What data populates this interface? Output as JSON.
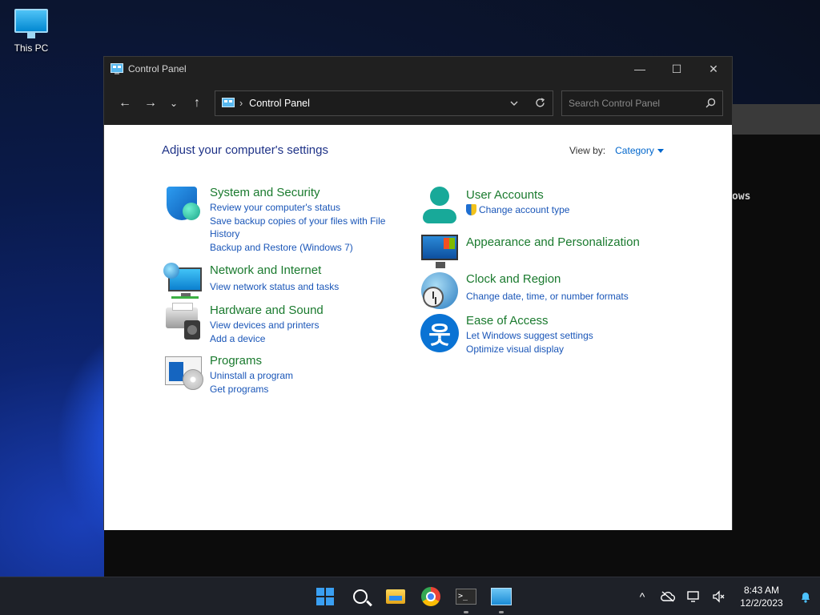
{
  "desktop": {
    "icon_label": "This PC",
    "bg_window_text": "ows"
  },
  "window": {
    "title": "Control Panel",
    "controls": {
      "minimize": "—",
      "maximize": "☐",
      "close": "✕"
    }
  },
  "toolbar": {
    "back": "←",
    "forward": "→",
    "recent": "⌄",
    "up": "↑",
    "breadcrumb": "Control Panel",
    "search_placeholder": "Search Control Panel"
  },
  "content": {
    "title": "Adjust your computer's settings",
    "view_by_label": "View by:",
    "view_by_value": "Category",
    "categories": [
      {
        "name": "System and Security",
        "icon": "shield-icon",
        "links": [
          "Review your computer's status",
          "Save backup copies of your files with File",
          "History",
          "Backup and Restore (Windows 7)"
        ]
      },
      {
        "name": "Network and Internet",
        "icon": "network-icon",
        "links": [
          "View network status and tasks"
        ]
      },
      {
        "name": "Hardware and Sound",
        "icon": "printer-icon",
        "links": [
          "View devices and printers",
          "Add a device"
        ]
      },
      {
        "name": "Programs",
        "icon": "programs-icon",
        "links": [
          "Uninstall a program",
          "Get programs"
        ]
      },
      {
        "name": "User Accounts",
        "icon": "user-icon",
        "links": [
          "Change account type"
        ]
      },
      {
        "name": "Appearance and Personalization",
        "icon": "appearance-icon",
        "links": []
      },
      {
        "name": "Clock and Region",
        "icon": "clock-icon",
        "links": [
          "Change date, time, or number formats"
        ]
      },
      {
        "name": "Ease of Access",
        "icon": "accessibility-icon",
        "links": [
          "Let Windows suggest settings",
          "Optimize visual display"
        ]
      }
    ]
  },
  "taskbar": {
    "time": "8:43 AM",
    "date": "12/2/2023",
    "tray_chevron": "^"
  },
  "colors": {
    "heading_green": "#1a7a2e",
    "link_blue": "#1a56b8",
    "title_blue": "#1e3287"
  }
}
